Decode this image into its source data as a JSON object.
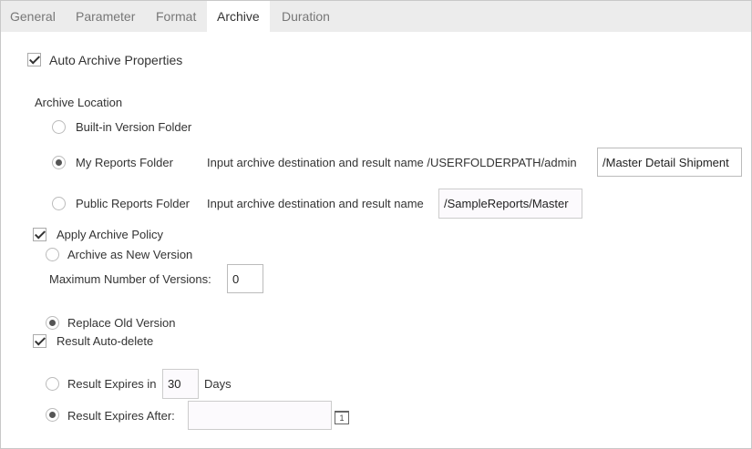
{
  "tabs": [
    {
      "label": "General"
    },
    {
      "label": "Parameter"
    },
    {
      "label": "Format"
    },
    {
      "label": "Archive",
      "active": true
    },
    {
      "label": "Duration"
    }
  ],
  "auto_archive": {
    "label": "Auto Archive Properties",
    "checked": true
  },
  "archive_location": {
    "heading": "Archive Location",
    "builtin": {
      "label": "Built-in Version Folder",
      "selected": false
    },
    "my_reports": {
      "label": "My Reports Folder",
      "selected": true,
      "hint": "Input archive destination and result name /USERFOLDERPATH/admin",
      "value": "/Master Detail Shipment"
    },
    "public_reports": {
      "label": "Public Reports Folder",
      "selected": false,
      "hint": "Input archive destination and result name",
      "value": "/SampleReports/Master"
    }
  },
  "archive_policy": {
    "label": "Apply Archive Policy",
    "checked": true,
    "new_version": {
      "label": "Archive as New Version",
      "selected": false
    },
    "max_versions": {
      "label": "Maximum Number of Versions:",
      "value": "0"
    },
    "replace": {
      "label": "Replace Old Version",
      "selected": true
    }
  },
  "auto_delete": {
    "label": "Result Auto-delete",
    "checked": true,
    "expires_in": {
      "label": "Result Expires in",
      "value": "30",
      "unit": "Days",
      "selected": false
    },
    "expires_after": {
      "label": "Result Expires After:",
      "value": "",
      "selected": true,
      "calendar_day": "1"
    }
  }
}
